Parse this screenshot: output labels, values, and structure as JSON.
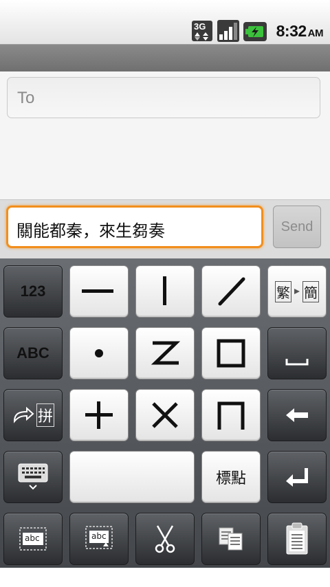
{
  "status_bar": {
    "network_type": "3G",
    "network_icon": "3g-data-icon",
    "signal_icon": "signal-strength-icon",
    "battery_icon": "battery-charging-icon",
    "time": "8:32",
    "ampm": "AM"
  },
  "compose": {
    "to_placeholder": "To"
  },
  "message": {
    "text": "關能都秦，來生芻奏",
    "send_label": "Send"
  },
  "keyboard": {
    "row1": {
      "mode_123": "123",
      "trad_simp_icon": "traditional-to-simplified-icon",
      "trad_char": "繁",
      "simp_char": "簡"
    },
    "row2": {
      "mode_abc": "ABC",
      "space_icon": "space-icon"
    },
    "row3": {
      "pinyin_char": "拼",
      "switch_icon": "switch-pinyin-icon",
      "backspace_icon": "backspace-icon"
    },
    "row4": {
      "punctuation": "標點",
      "keyboard_icon": "hide-keyboard-icon",
      "enter_icon": "enter-icon"
    },
    "row5": {
      "select_icon": "select-text-icon",
      "select_all_icon": "select-all-icon",
      "cut_icon": "cut-icon",
      "copy_icon": "copy-icon",
      "paste_icon": "paste-icon",
      "abc_small": "abc"
    },
    "strokes": [
      "horizontal-stroke",
      "vertical-stroke",
      "left-falling-stroke",
      "dot-stroke",
      "z-fold-stroke",
      "square-stroke",
      "plus-stroke",
      "cross-stroke",
      "hook-stroke"
    ]
  }
}
